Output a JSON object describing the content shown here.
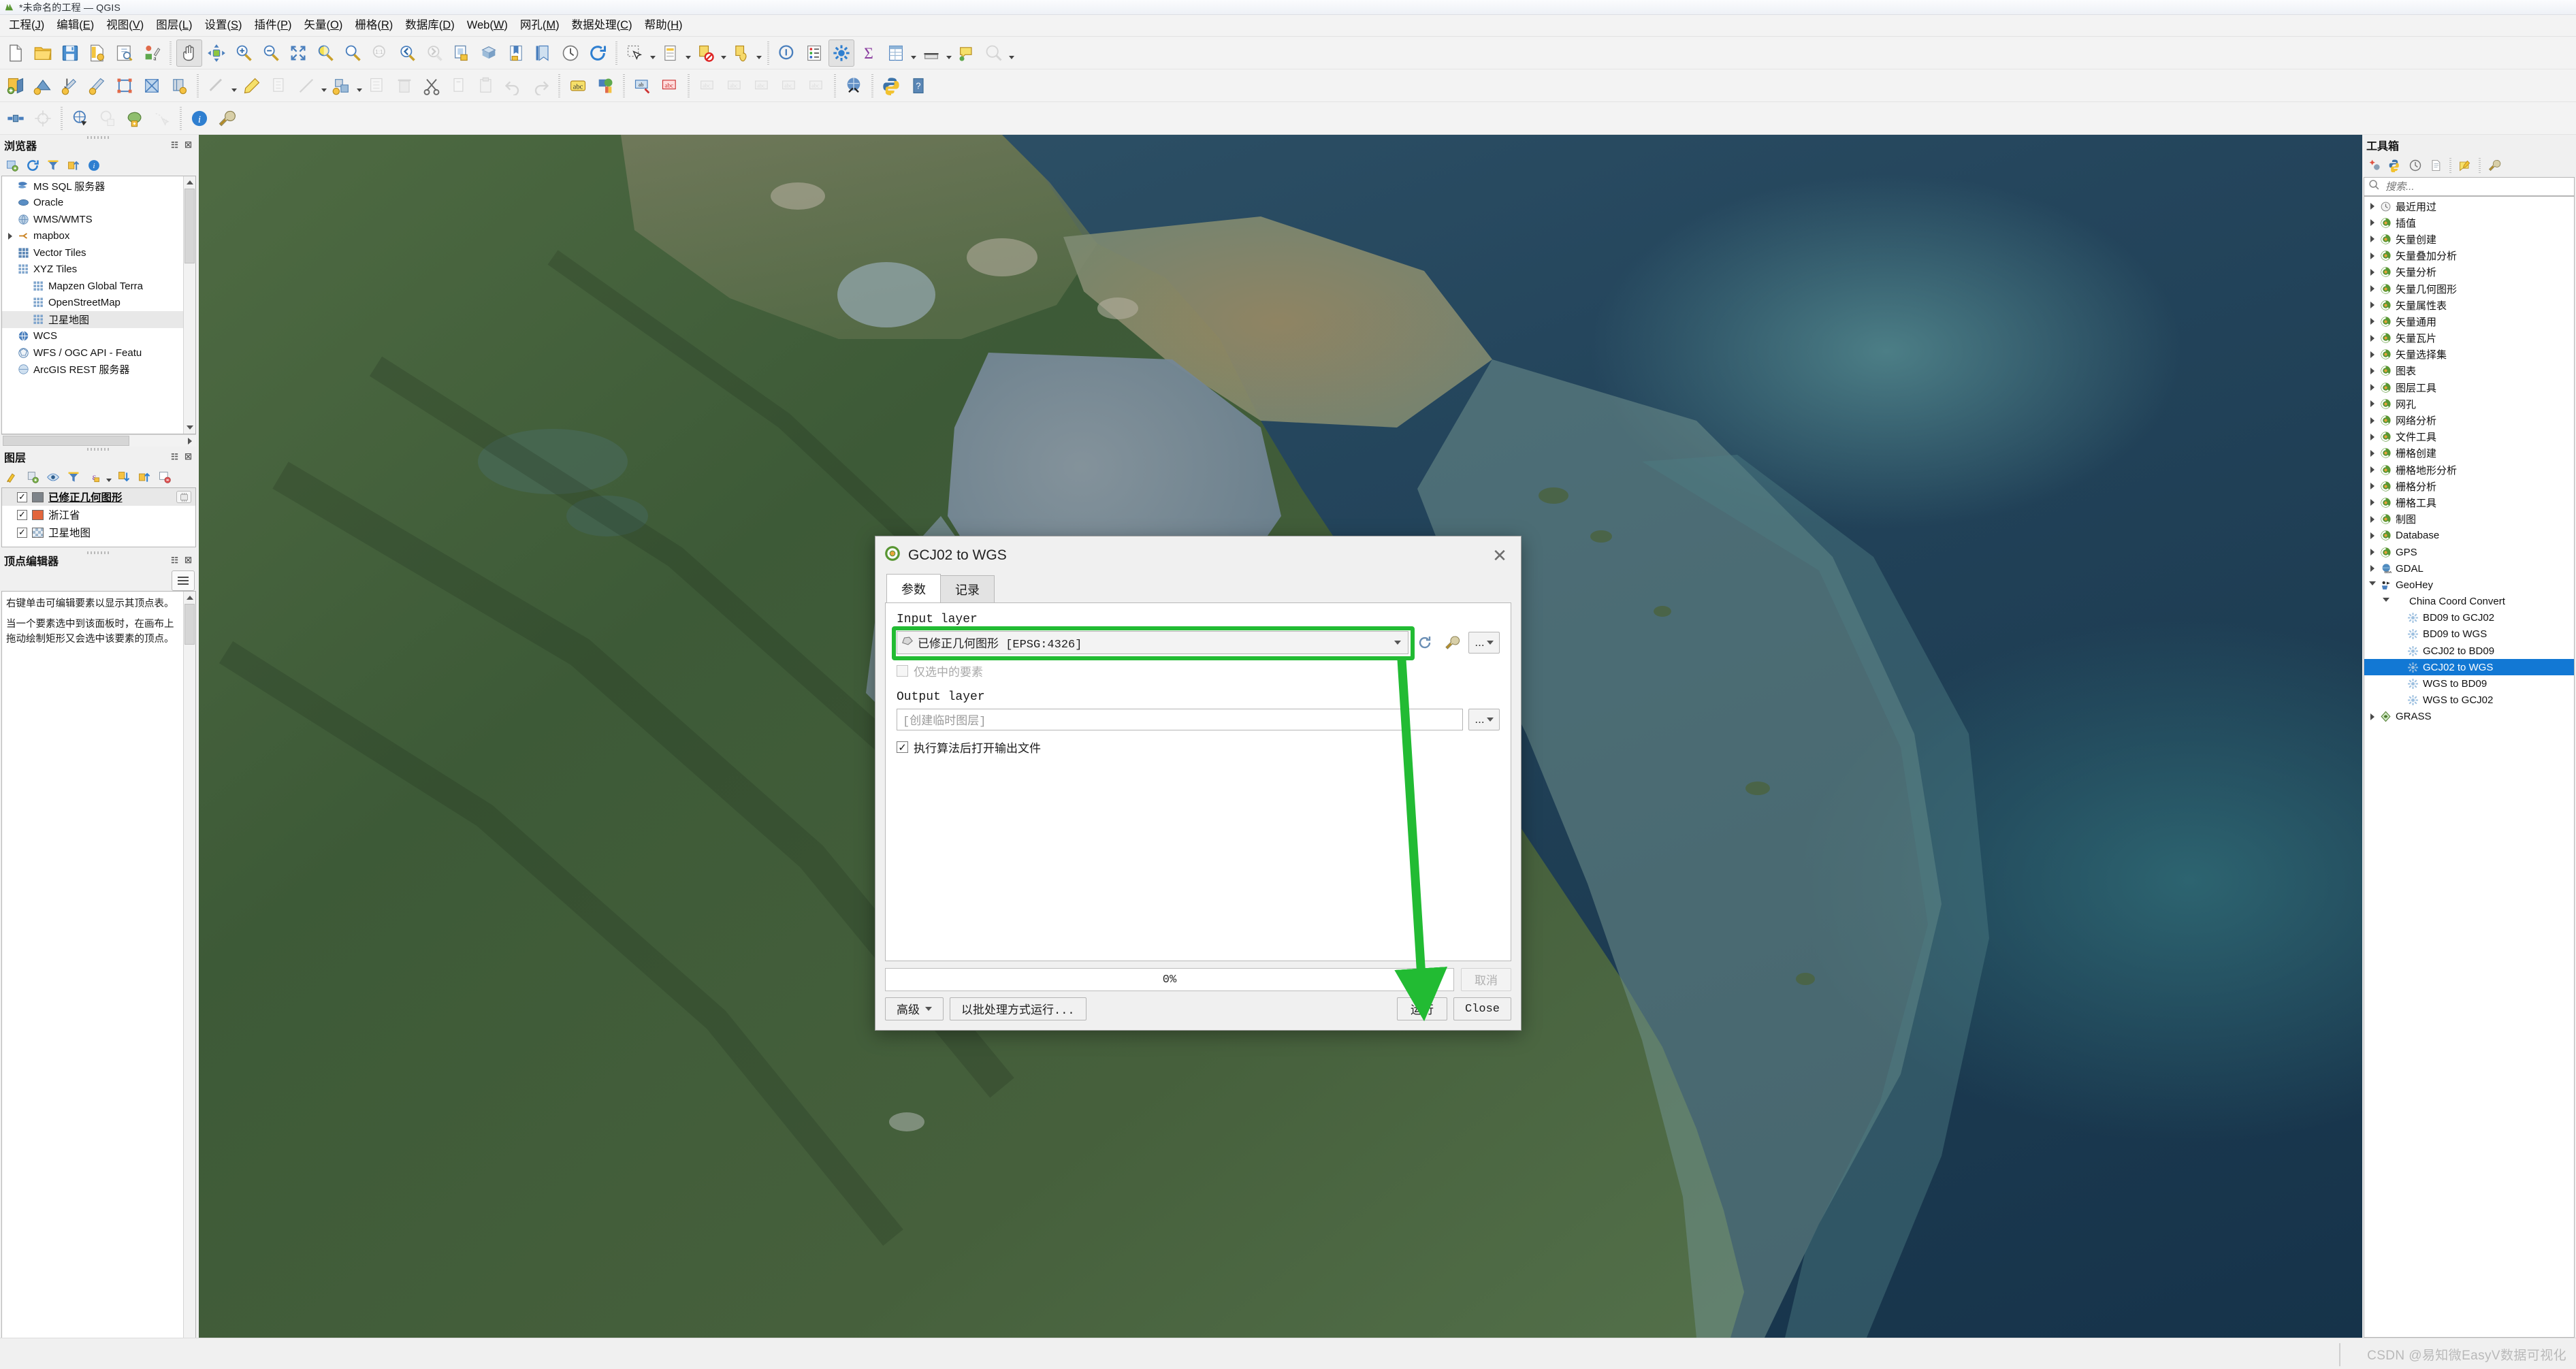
{
  "window": {
    "title": "*未命名的工程 — QGIS",
    "logo_icon": "qgis-logo-icon"
  },
  "menubar": {
    "items": [
      {
        "label": "工程(J)"
      },
      {
        "label": "编辑(E)"
      },
      {
        "label": "视图(V)"
      },
      {
        "label": "图层(L)"
      },
      {
        "label": "设置(S)"
      },
      {
        "label": "插件(P)"
      },
      {
        "label": "矢量(O)"
      },
      {
        "label": "栅格(R)"
      },
      {
        "label": "数据库(D)"
      },
      {
        "label": "Web(W)"
      },
      {
        "label": "网孔(M)"
      },
      {
        "label": "数据处理(C)"
      },
      {
        "label": "帮助(H)"
      }
    ]
  },
  "browser_panel": {
    "title": "浏览器",
    "toolbar_icons": [
      "add-layer-icon",
      "refresh-icon",
      "filter-icon",
      "collapse-all-icon",
      "info-icon"
    ],
    "items": [
      {
        "label": "MS SQL 服务器",
        "icon": "mssql-icon",
        "indent": 0,
        "expandable": false,
        "selected": false
      },
      {
        "label": "Oracle",
        "icon": "oracle-icon",
        "indent": 0,
        "expandable": false,
        "selected": false
      },
      {
        "label": "WMS/WMTS",
        "icon": "wms-icon",
        "indent": 0,
        "expandable": false,
        "selected": false
      },
      {
        "label": "mapbox",
        "icon": "mapbox-icon",
        "indent": 0,
        "expandable": true,
        "selected": false
      },
      {
        "label": "Vector Tiles",
        "icon": "vector-tiles-icon",
        "indent": 0,
        "expandable": false,
        "selected": false
      },
      {
        "label": "XYZ Tiles",
        "icon": "xyz-tiles-icon",
        "indent": 0,
        "expandable": false,
        "selected": false
      },
      {
        "label": "Mapzen Global Terra",
        "icon": "xyz-tiles-icon",
        "indent": 1,
        "expandable": false,
        "selected": false
      },
      {
        "label": "OpenStreetMap",
        "icon": "xyz-tiles-icon",
        "indent": 1,
        "expandable": false,
        "selected": false
      },
      {
        "label": "卫星地图",
        "icon": "xyz-tiles-icon",
        "indent": 1,
        "expandable": false,
        "selected": true
      },
      {
        "label": "WCS",
        "icon": "wcs-icon",
        "indent": 0,
        "expandable": false,
        "selected": false
      },
      {
        "label": "WFS / OGC API - Featu",
        "icon": "wfs-icon",
        "indent": 0,
        "expandable": false,
        "selected": false
      },
      {
        "label": "ArcGIS REST 服务器",
        "icon": "arcgis-icon",
        "indent": 0,
        "expandable": false,
        "selected": false
      }
    ]
  },
  "layers_panel": {
    "title": "图层",
    "toolbar_icons": [
      "style-manager-icon",
      "add-group-icon",
      "show-all-icon",
      "filter-legend-icon",
      "expression-filter-icon",
      "expand-all-icon",
      "collapse-all-icon",
      "remove-layer-icon"
    ],
    "layers": [
      {
        "label": "已修正几何图形",
        "checked": true,
        "swatch": "#7d8389",
        "selected": true,
        "underline": true,
        "badge": "memory-layer-icon"
      },
      {
        "label": "浙江省",
        "checked": true,
        "swatch": "#e2653c",
        "selected": false,
        "underline": false,
        "badge": ""
      },
      {
        "label": "卫星地图",
        "checked": true,
        "swatch": "checker",
        "selected": false,
        "underline": false,
        "badge": ""
      }
    ]
  },
  "vertex_panel": {
    "title": "顶点编辑器",
    "menu_icon": "hamburger-icon",
    "paragraphs": [
      "右键单击可编辑要素以显示其顶点表。",
      "当一个要素选中到该面板时，在画布上拖动绘制矩形又会选中该要素的顶点。"
    ]
  },
  "toolbox_panel": {
    "title": "工具箱",
    "toolbar_icons": [
      "models-icon",
      "python-scripts-icon",
      "history-icon",
      "results-icon",
      "edit-model-icon",
      "options-icon"
    ],
    "search": {
      "placeholder": "搜索...",
      "value": "",
      "icon": "search-icon"
    },
    "items": [
      {
        "label": "最近用过",
        "icon": "clock-icon",
        "indent": 0,
        "expandable": true,
        "expanded": false,
        "selected": false
      },
      {
        "label": "插值",
        "icon": "qgis-provider-icon",
        "indent": 0,
        "expandable": true,
        "expanded": false,
        "selected": false
      },
      {
        "label": "矢量创建",
        "icon": "qgis-provider-icon",
        "indent": 0,
        "expandable": true,
        "expanded": false,
        "selected": false
      },
      {
        "label": "矢量叠加分析",
        "icon": "qgis-provider-icon",
        "indent": 0,
        "expandable": true,
        "expanded": false,
        "selected": false
      },
      {
        "label": "矢量分析",
        "icon": "qgis-provider-icon",
        "indent": 0,
        "expandable": true,
        "expanded": false,
        "selected": false
      },
      {
        "label": "矢量几何图形",
        "icon": "qgis-provider-icon",
        "indent": 0,
        "expandable": true,
        "expanded": false,
        "selected": false
      },
      {
        "label": "矢量属性表",
        "icon": "qgis-provider-icon",
        "indent": 0,
        "expandable": true,
        "expanded": false,
        "selected": false
      },
      {
        "label": "矢量通用",
        "icon": "qgis-provider-icon",
        "indent": 0,
        "expandable": true,
        "expanded": false,
        "selected": false
      },
      {
        "label": "矢量瓦片",
        "icon": "qgis-provider-icon",
        "indent": 0,
        "expandable": true,
        "expanded": false,
        "selected": false
      },
      {
        "label": "矢量选择集",
        "icon": "qgis-provider-icon",
        "indent": 0,
        "expandable": true,
        "expanded": false,
        "selected": false
      },
      {
        "label": "图表",
        "icon": "qgis-provider-icon",
        "indent": 0,
        "expandable": true,
        "expanded": false,
        "selected": false
      },
      {
        "label": "图层工具",
        "icon": "qgis-provider-icon",
        "indent": 0,
        "expandable": true,
        "expanded": false,
        "selected": false
      },
      {
        "label": "网孔",
        "icon": "qgis-provider-icon",
        "indent": 0,
        "expandable": true,
        "expanded": false,
        "selected": false
      },
      {
        "label": "网络分析",
        "icon": "qgis-provider-icon",
        "indent": 0,
        "expandable": true,
        "expanded": false,
        "selected": false
      },
      {
        "label": "文件工具",
        "icon": "qgis-provider-icon",
        "indent": 0,
        "expandable": true,
        "expanded": false,
        "selected": false
      },
      {
        "label": "栅格创建",
        "icon": "qgis-provider-icon",
        "indent": 0,
        "expandable": true,
        "expanded": false,
        "selected": false
      },
      {
        "label": "栅格地形分析",
        "icon": "qgis-provider-icon",
        "indent": 0,
        "expandable": true,
        "expanded": false,
        "selected": false
      },
      {
        "label": "栅格分析",
        "icon": "qgis-provider-icon",
        "indent": 0,
        "expandable": true,
        "expanded": false,
        "selected": false
      },
      {
        "label": "栅格工具",
        "icon": "qgis-provider-icon",
        "indent": 0,
        "expandable": true,
        "expanded": false,
        "selected": false
      },
      {
        "label": "制图",
        "icon": "qgis-provider-icon",
        "indent": 0,
        "expandable": true,
        "expanded": false,
        "selected": false
      },
      {
        "label": "Database",
        "icon": "qgis-provider-icon",
        "indent": 0,
        "expandable": true,
        "expanded": false,
        "selected": false
      },
      {
        "label": "GPS",
        "icon": "qgis-provider-icon",
        "indent": 0,
        "expandable": true,
        "expanded": false,
        "selected": false
      },
      {
        "label": "GDAL",
        "icon": "gdal-icon",
        "indent": 0,
        "expandable": true,
        "expanded": false,
        "selected": false
      },
      {
        "label": "GeoHey",
        "icon": "geohey-icon",
        "indent": 0,
        "expandable": true,
        "expanded": true,
        "selected": false
      },
      {
        "label": "China Coord Convert",
        "icon": "",
        "indent": 1,
        "expandable": true,
        "expanded": true,
        "selected": false
      },
      {
        "label": "BD09 to GCJ02",
        "icon": "algorithm-icon",
        "indent": 2,
        "expandable": false,
        "expanded": false,
        "selected": false
      },
      {
        "label": "BD09 to WGS",
        "icon": "algorithm-icon",
        "indent": 2,
        "expandable": false,
        "expanded": false,
        "selected": false
      },
      {
        "label": "GCJ02 to BD09",
        "icon": "algorithm-icon",
        "indent": 2,
        "expandable": false,
        "expanded": false,
        "selected": false
      },
      {
        "label": "GCJ02 to WGS",
        "icon": "algorithm-icon",
        "indent": 2,
        "expandable": false,
        "expanded": false,
        "selected": true
      },
      {
        "label": "WGS to BD09",
        "icon": "algorithm-icon",
        "indent": 2,
        "expandable": false,
        "expanded": false,
        "selected": false
      },
      {
        "label": "WGS to GCJ02",
        "icon": "algorithm-icon",
        "indent": 2,
        "expandable": false,
        "expanded": false,
        "selected": false
      },
      {
        "label": "GRASS",
        "icon": "grass-icon",
        "indent": 0,
        "expandable": true,
        "expanded": false,
        "selected": false
      }
    ]
  },
  "dialog": {
    "title": "GCJ02 to WGS",
    "icon": "qgis-logo-icon",
    "close_icon": "close-icon",
    "tabs": [
      {
        "label": "参数",
        "active": true
      },
      {
        "label": "记录",
        "active": false
      }
    ],
    "input_layer": {
      "label": "Input layer",
      "value": "已修正几何图形 [EPSG:4326]",
      "layer_icon": "polygon-layer-icon",
      "dropdown_icon": "chevron-down-icon",
      "iterate_icon": "iterate-icon",
      "wrench_icon": "wrench-icon",
      "browse_label": "..."
    },
    "selected_only": {
      "label": "仅选中的要素",
      "checked": false,
      "disabled": true
    },
    "output_layer": {
      "label": "Output layer",
      "placeholder": "[创建临时图层]",
      "value": "",
      "browse_label": "..."
    },
    "open_output": {
      "label": "执行算法后打开输出文件",
      "checked": true
    },
    "progress": {
      "text": "0%",
      "percent": 0
    },
    "buttons": {
      "advanced": "高级",
      "run_as_batch": "以批处理方式运行...",
      "cancel": "取消",
      "run": "运行",
      "close": "Close"
    }
  },
  "annotations": {
    "highlight_color": "#22bb33",
    "arrow_color": "#22bb33",
    "arrow_target": "run-button"
  },
  "statusbar": {
    "watermark": "CSDN @易知微EasyV数据可视化"
  }
}
